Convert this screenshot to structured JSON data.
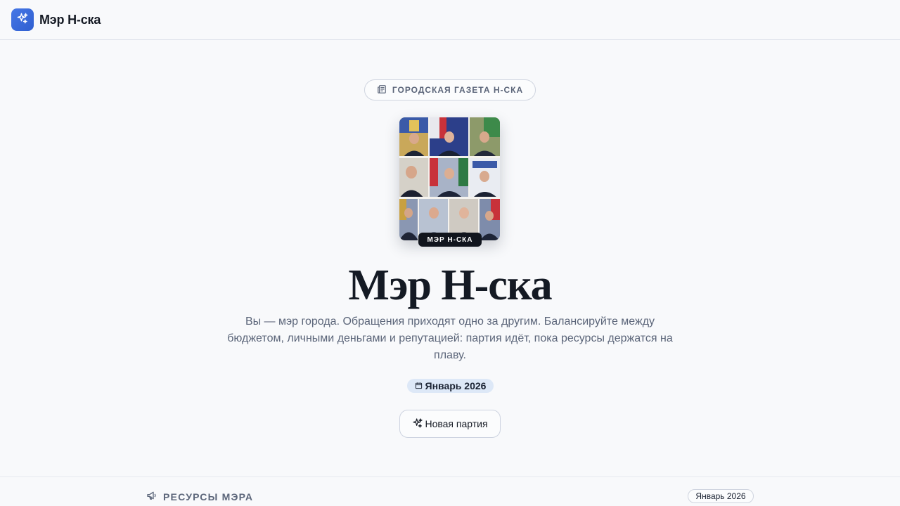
{
  "header": {
    "app_title": "Мэр Н-ска",
    "logo_icon": "sparkles-icon"
  },
  "hero": {
    "badge": "ГОРОДСКАЯ ГАЗЕТА Н-СКА",
    "badge_icon": "newspaper-icon",
    "photo_label": "МЭР Н-СКА",
    "title": "Мэр Н-ска",
    "description": "Вы — мэр города. Обращения приходят одно за другим. Балансируйте между бюджетом, личными деньгами и репутацией: партия идёт, пока ресурсы держатся на плаву.",
    "date": "Январь 2026",
    "date_icon": "calendar-icon",
    "new_game_button": "Новая партия",
    "new_game_icon": "sparkles-icon"
  },
  "resources": {
    "title": "РЕСУРСЫ МЭРА",
    "title_icon": "megaphone-icon",
    "date": "Январь 2026"
  },
  "colors": {
    "accent": "#3b6fe0",
    "text": "#141a24",
    "muted": "#5b6579",
    "date_chip": "#dde8f7"
  }
}
